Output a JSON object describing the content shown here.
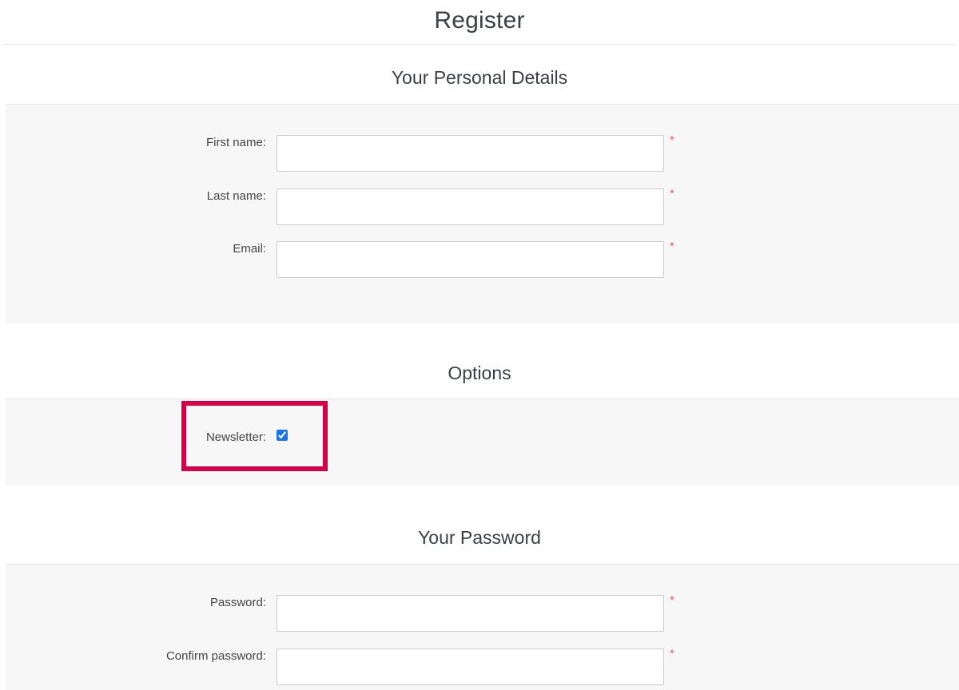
{
  "page": {
    "title": "Register"
  },
  "sections": [
    {
      "heading": "Your Personal Details",
      "fields": [
        {
          "label": "First name:",
          "value": "",
          "placeholder": "",
          "type": "text",
          "required_marker": "*"
        },
        {
          "label": "Last name:",
          "value": "",
          "placeholder": "",
          "type": "text",
          "required_marker": "*"
        },
        {
          "label": "Email:",
          "value": "",
          "placeholder": "",
          "type": "text",
          "required_marker": "*"
        }
      ]
    },
    {
      "heading": "Options",
      "fields": [
        {
          "label": "Newsletter:",
          "value": "checked",
          "type": "checkbox",
          "required_marker": ""
        }
      ]
    },
    {
      "heading": "Your Password",
      "fields": [
        {
          "label": "Password:",
          "value": "",
          "placeholder": "",
          "type": "password",
          "required_marker": "*"
        },
        {
          "label": "Confirm password:",
          "value": "",
          "placeholder": "",
          "type": "password",
          "required_marker": "*"
        }
      ]
    }
  ],
  "annotation": {
    "target": "newsletter-checkbox-row",
    "color": "#d4004a"
  },
  "colors": {
    "panel_background": "#f7f7f7",
    "divider": "#e8e8e8",
    "required_asterisk": "#eb5a63",
    "checkbox_checked": "#1a73e8",
    "heading_text": "#3a3f44",
    "label_text": "#444444",
    "input_border": "#cccccc",
    "annotation": "#d4004a"
  }
}
